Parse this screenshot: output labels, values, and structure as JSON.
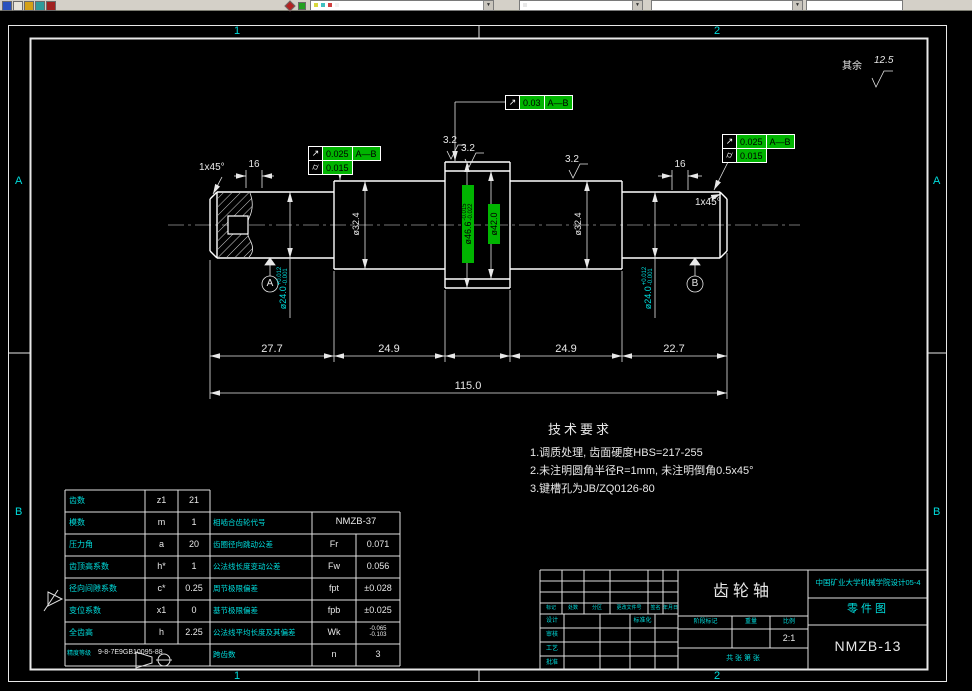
{
  "icons": {
    "dropdown_arrow": "▼"
  },
  "frame": {
    "zone_top_1": "1",
    "zone_top_2": "2",
    "zone_bottom_1": "1",
    "zone_bottom_2": "2",
    "zone_left_a": "A",
    "zone_left_b": "B",
    "zone_right_a": "A",
    "zone_right_b": "B"
  },
  "drawing": {
    "surface": {
      "rest_label": "其余",
      "rest_value": "12.5",
      "r1": "3.2",
      "r2": "3.2",
      "r3": "3.2"
    },
    "chamfer_left": "1x45°",
    "chamfer_right": "1x45°",
    "keyway_left": "16",
    "keyway_right": "16",
    "gdt": {
      "runout_symbol": "↗",
      "cyl_symbol": "⌭",
      "top": {
        "value": "0.03",
        "datum": "A—B"
      },
      "left1": {
        "value": "0.025",
        "datum": "A—B"
      },
      "left2": {
        "value": "0.015"
      },
      "right1": {
        "value": "0.025",
        "datum": "A—B"
      },
      "right2": {
        "value": "0.015"
      }
    },
    "datum_a": "A",
    "datum_b": "B",
    "dims": {
      "d24": {
        "main": "ø24.0",
        "upper": "+0.012",
        "lower": "-0.001"
      },
      "d46": {
        "main": "ø46.6",
        "upper": "-0.015",
        "lower": "-0.022"
      },
      "d42": {
        "main": "ø42.0"
      },
      "d32": {
        "main": "ø32.4"
      },
      "len1": "27.7",
      "len2": "24.9",
      "len3": "24.9",
      "len4": "22.7",
      "total": "115.0"
    }
  },
  "tech_req": {
    "title": "技术要求",
    "item1": "1.调质处理, 齿面硬度HBS=217-255",
    "item2": "2.未注明圆角半径R=1mm, 未注明倒角0.5x45°",
    "item3": "3.键槽孔为JB/ZQ0126-80"
  },
  "param_table": {
    "left_rows": [
      {
        "name": "齿数",
        "sym": "z1",
        "val": "21"
      },
      {
        "name": "模数",
        "sym": "m",
        "val": "1"
      },
      {
        "name": "压力角",
        "sym": "a",
        "val": "20"
      },
      {
        "name": "齿顶高系数",
        "sym": "h*",
        "val": "1"
      },
      {
        "name": "径向间隙系数",
        "sym": "c*",
        "val": "0.25"
      },
      {
        "name": "变位系数",
        "sym": "x1",
        "val": "0"
      },
      {
        "name": "全齿高",
        "sym": "h",
        "val": "2.25"
      }
    ],
    "precision_label": "精度等级",
    "precision_value": "9-8-7E9GB10095-88",
    "right_rows": [
      {
        "name": "相啮合齿轮代号",
        "val": "NMZB-37"
      },
      {
        "name": "齿圈径向跳动公差",
        "sym": "Fr",
        "val": "0.071"
      },
      {
        "name": "公法线长度变动公差",
        "sym": "Fw",
        "val": "0.056"
      },
      {
        "name": "周节极限偏差",
        "sym": "fpt",
        "val": "±0.028"
      },
      {
        "name": "基节极限偏差",
        "sym": "fpb",
        "val": "±0.025"
      },
      {
        "name": "公法线平均长度及其偏差",
        "sym": "Wk",
        "upper": "-0.065",
        "lower": "-0.103"
      },
      {
        "name": "跨齿数",
        "sym": "n",
        "val": "3"
      }
    ]
  },
  "title_block": {
    "part_name": "齿轮轴",
    "org": "中国矿业大学机械学院设计05-4",
    "doc_type": "零件图",
    "drawing_no": "NMZB-13",
    "stage_label": "阶段标记",
    "weight_label": "重量",
    "scale_label": "比例",
    "scale_value": "2:1",
    "sheet_text": "共  张  第  张",
    "rev_headers": [
      "标记",
      "处数",
      "分区",
      "更改文件号",
      "签名",
      "年月日"
    ],
    "sig_design": "设计",
    "sig_check": "审核",
    "sig_process": "工艺",
    "sig_approve": "批准",
    "sig_standard": "标准化"
  }
}
